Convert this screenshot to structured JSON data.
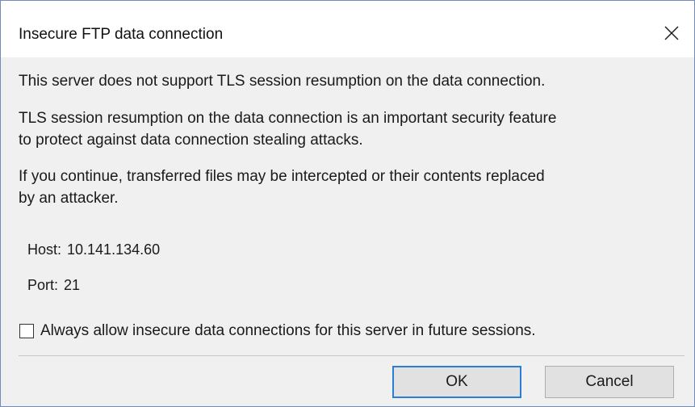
{
  "dialog": {
    "title": "Insecure FTP data connection",
    "close_icon": "close-icon"
  },
  "message": {
    "line1": "This server does not support TLS session resumption on the data connection.",
    "line2a": "TLS session resumption on the data connection is an important security feature",
    "line2b": "to protect against data connection stealing attacks.",
    "line3a": "If you continue, transferred files may be intercepted or their contents replaced",
    "line3b": "by an attacker."
  },
  "details": {
    "host_label": "Host:",
    "host_value": "10.141.134.60",
    "port_label": "Port:",
    "port_value": "21"
  },
  "option": {
    "checkbox_label": "Always allow insecure data connections for this server in future sessions.",
    "checked": false
  },
  "buttons": {
    "ok_label": "OK",
    "cancel_label": "Cancel"
  },
  "colors": {
    "focus_border": "#2a7fd4",
    "window_border": "#6f8db8",
    "dialog_background": "#f0f0f0"
  }
}
